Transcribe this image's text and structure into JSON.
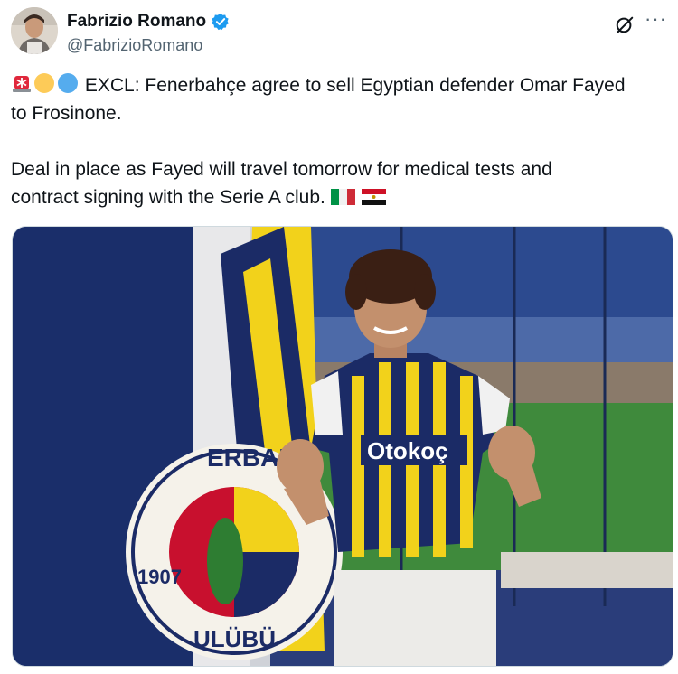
{
  "author": {
    "display_name": "Fabrizio Romano",
    "handle": "@FabrizioRomano",
    "avatar_icon": "avatar-photo",
    "verified_icon": "verified-badge-icon",
    "verified_color": "#1d9bf0"
  },
  "actions": {
    "grok_icon": "grok-icon",
    "more_label": "···"
  },
  "tweet": {
    "line1": "EXCL: Fenerbahçe agree to sell Egyptian defender Omar Fayed",
    "line2": "to Frosinone.",
    "line3": "Deal in place as Fayed will travel tomorrow for medical tests and",
    "line4": "contract signing with the Serie A club.",
    "leading_emojis": [
      "siren-emoji",
      "yellow-circle-emoji",
      "blue-circle-emoji"
    ],
    "trailing_emojis": [
      "italy-flag-emoji",
      "egypt-flag-emoji"
    ]
  },
  "media": {
    "kind": "photo",
    "shirt_sponsor": "Otokoç",
    "crest_text_top": "ERBAH",
    "crest_text_bottom": "ULÜBÜ",
    "crest_year": "1907",
    "colors": {
      "yellow": "#f2d21b",
      "navy": "#1b2b66",
      "wall": "#23397a"
    }
  }
}
